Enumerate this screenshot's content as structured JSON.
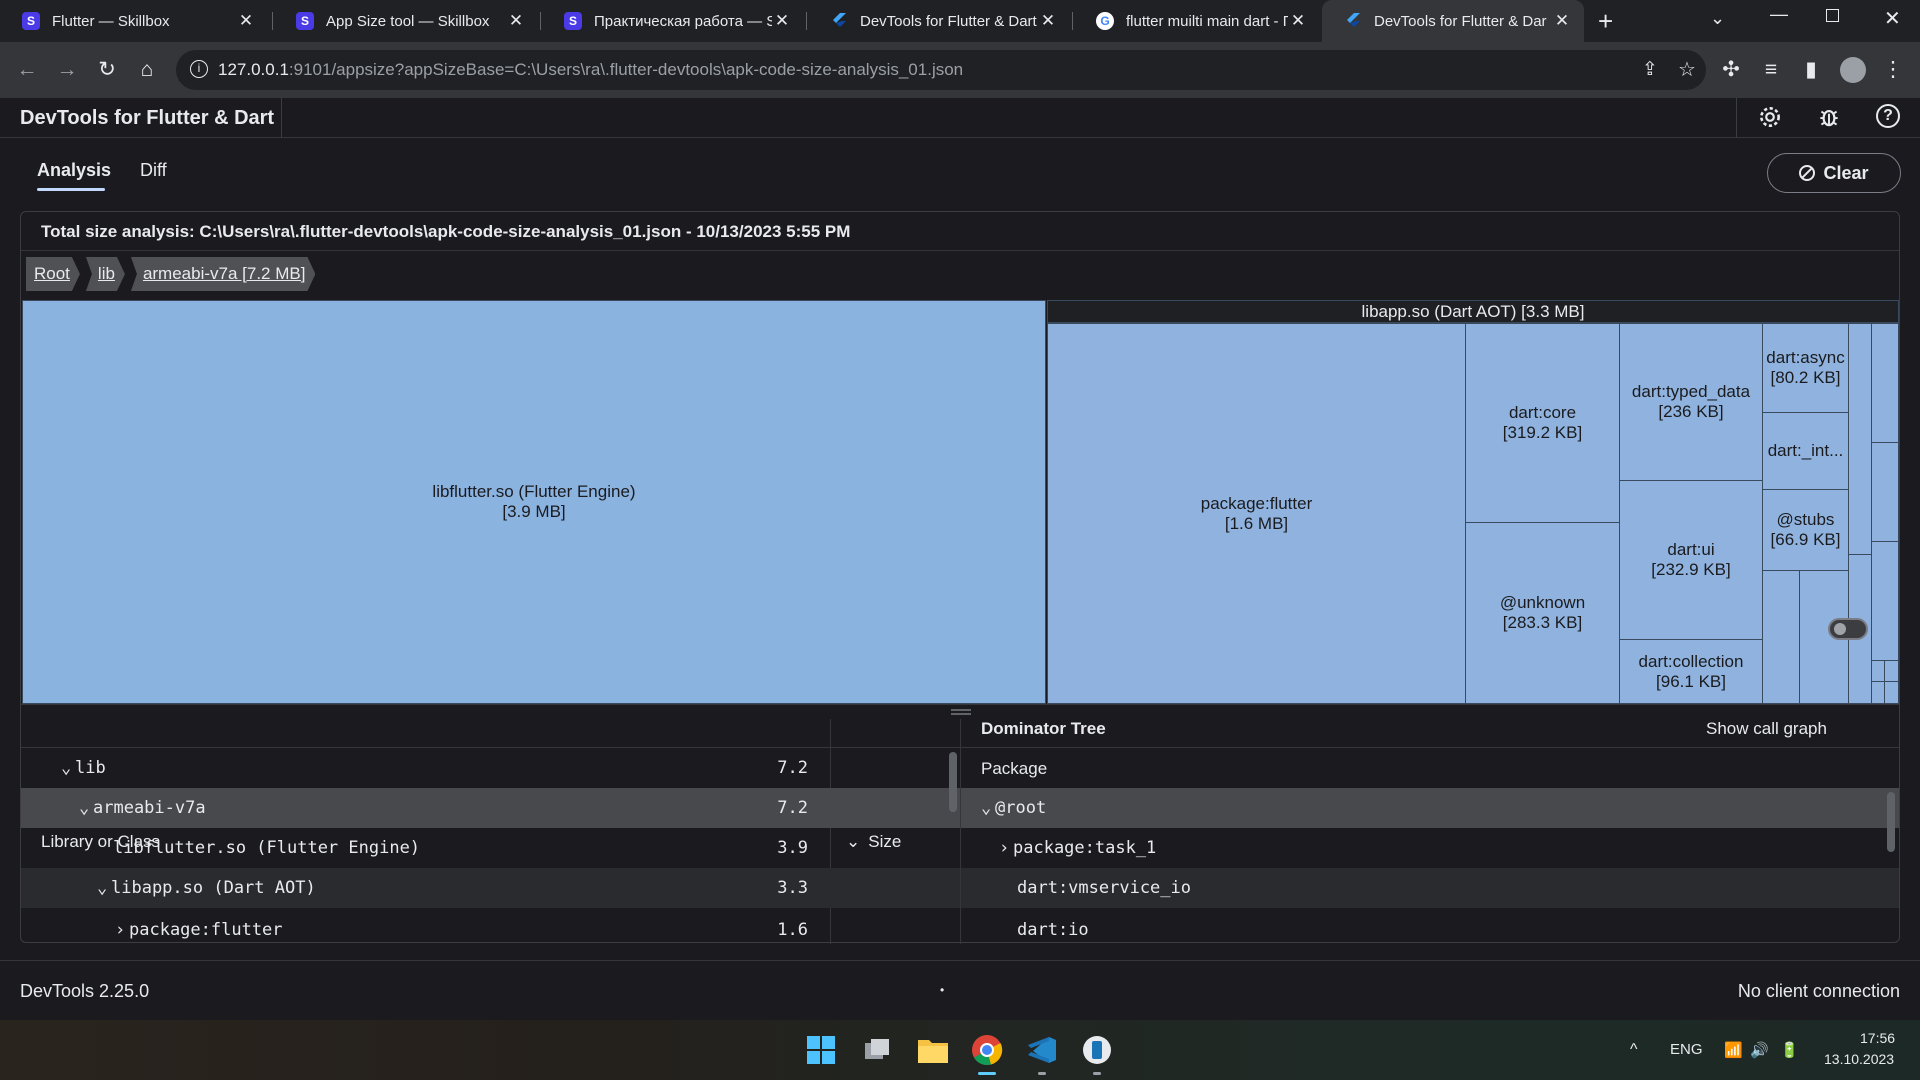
{
  "browser": {
    "tabs": [
      {
        "title": "Flutter — Skillbox",
        "favicon": "skillbox-icon"
      },
      {
        "title": "App Size tool — Skillbox",
        "favicon": "skillbox-icon"
      },
      {
        "title": "Практическая работа — S",
        "favicon": "skillbox-icon"
      },
      {
        "title": "DevTools for Flutter & Dart",
        "favicon": "devtools-icon"
      },
      {
        "title": "flutter muilti main dart - П",
        "favicon": "google-icon"
      },
      {
        "title": "DevTools for Flutter & Dar",
        "favicon": "devtools-icon",
        "active": true
      }
    ],
    "url_host": "127.0.0.1",
    "url_rest": ":9101/appsize?appSizeBase=C:\\Users\\ra\\.flutter-devtools\\apk-code-size-analysis_01.json"
  },
  "app": {
    "title": "DevTools for Flutter & Dart",
    "subtabs": [
      "Analysis",
      "Diff"
    ],
    "clear_label": "Clear",
    "total_line": "Total size analysis: C:\\Users\\ra\\.flutter-devtools\\apk-code-size-analysis_01.json - 10/13/2023 5:55 PM",
    "breadcrumbs": [
      "Root",
      "lib",
      "armeabi-v7a [7.2 MB]"
    ]
  },
  "treemap": {
    "libflutter": {
      "name": "libflutter.so (Flutter Engine)",
      "size": "[3.9 MB]"
    },
    "libapp_header": "libapp.so (Dart AOT) [3.3 MB]",
    "package_flutter": {
      "name": "package:flutter",
      "size": "[1.6 MB]"
    },
    "dart_core": {
      "name": "dart:core",
      "size": "[319.2 KB]"
    },
    "unknown": {
      "name": "@unknown",
      "size": "[283.3 KB]"
    },
    "dart_typed_data": {
      "name": "dart:typed_data",
      "size": "[236 KB]"
    },
    "dart_ui": {
      "name": "dart:ui",
      "size": "[232.9 KB]"
    },
    "dart_collection": {
      "name": "dart:collection",
      "size": "[96.1 KB]"
    },
    "dart_async": {
      "name": "dart:async",
      "size": "[80.2 KB]"
    },
    "dart_int": {
      "name": "dart:_int..."
    },
    "stubs": {
      "name": "@stubs",
      "size": "[66.9 KB]"
    }
  },
  "library_table": {
    "col_name": "Library or Class",
    "col_size": "Size",
    "rows": [
      {
        "label": "lib",
        "size": "7.2"
      },
      {
        "label": "armeabi-v7a",
        "size": "7.2"
      },
      {
        "label": "libflutter.so (Flutter Engine)",
        "size": "3.9"
      },
      {
        "label": "libapp.so (Dart AOT)",
        "size": "3.3"
      },
      {
        "label": "package:flutter",
        "size": "1.6"
      }
    ]
  },
  "dominator": {
    "title": "Dominator Tree",
    "call_graph_label": "Show call graph",
    "col": "Package",
    "rows": [
      {
        "label": "@root"
      },
      {
        "label": "package:task_1"
      },
      {
        "label": "dart:vmservice_io"
      },
      {
        "label": "dart:io"
      }
    ]
  },
  "status": {
    "version": "DevTools 2.25.0",
    "dot": "•",
    "connection": "No client connection"
  },
  "taskbar": {
    "lang": "ENG",
    "time": "17:56",
    "date": "13.10.2023"
  }
}
